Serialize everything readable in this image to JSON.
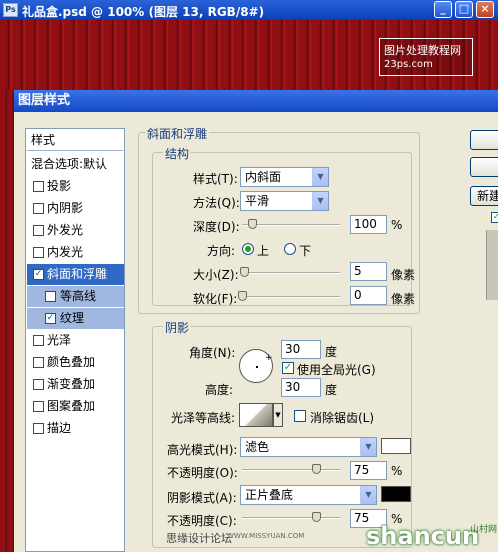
{
  "window": {
    "title": "礼品盒.psd @ 100% (图层 13, RGB/8#)",
    "buttons": {
      "minimize": "_",
      "maximize": "□",
      "close": "×"
    },
    "app_icon": "Ps"
  },
  "watermark": {
    "line1": "图片处理教程网",
    "line2": "23ps.com"
  },
  "dialog": {
    "title": "图层样式",
    "right_buttons": {
      "new_style": "新建"
    },
    "preview_check": "✓"
  },
  "style_list": {
    "header": "样式",
    "blend": "混合选项:默认",
    "items": [
      {
        "label": "投影",
        "checked": ""
      },
      {
        "label": "内阴影",
        "checked": ""
      },
      {
        "label": "外发光",
        "checked": ""
      },
      {
        "label": "内发光",
        "checked": ""
      },
      {
        "label": "斜面和浮雕",
        "checked": "✓"
      },
      {
        "label": "等高线",
        "checked": ""
      },
      {
        "label": "纹理",
        "checked": "✓"
      },
      {
        "label": "光泽",
        "checked": ""
      },
      {
        "label": "颜色叠加",
        "checked": ""
      },
      {
        "label": "渐变叠加",
        "checked": ""
      },
      {
        "label": "图案叠加",
        "checked": ""
      },
      {
        "label": "描边",
        "checked": ""
      }
    ]
  },
  "bevel": {
    "section_title": "斜面和浮雕",
    "structure_title": "结构",
    "style_label": "样式(T):",
    "style_value": "内斜面",
    "technique_label": "方法(Q):",
    "technique_value": "平滑",
    "depth_label": "深度(D):",
    "depth_value": "100",
    "depth_unit": "%",
    "depth_level": 0.1,
    "direction_label": "方向:",
    "direction_up": "上",
    "direction_down": "下",
    "size_label": "大小(Z):",
    "size_value": "5",
    "size_unit": "像素",
    "size_level": 0.02,
    "soften_label": "软化(F):",
    "soften_value": "0",
    "soften_unit": "像素",
    "soften_level": 0.0
  },
  "shading": {
    "title": "阴影",
    "angle_label": "角度(N):",
    "angle_value": "30",
    "angle_unit": "度",
    "global_light_label": "使用全局光(G)",
    "global_light_checked": "✓",
    "altitude_label": "高度:",
    "altitude_value": "30",
    "altitude_unit": "度",
    "gloss_label": "光泽等高线:",
    "anti_alias_label": "消除锯齿(L)",
    "highlight_mode_label": "高光模式(H):",
    "highlight_mode_value": "滤色",
    "highlight_color": "#ffffff",
    "highlight_opacity_label": "不透明度(O):",
    "highlight_opacity_value": "75",
    "highlight_opacity_unit": "%",
    "highlight_opacity_level": 0.75,
    "shadow_mode_label": "阴影模式(A):",
    "shadow_mode_value": "正片叠底",
    "shadow_color": "#000000",
    "shadow_opacity_label": "不透明度(C):",
    "shadow_opacity_value": "75",
    "shadow_opacity_unit": "%",
    "shadow_opacity_level": 0.75
  },
  "footer": {
    "forum": "思缘设计论坛",
    "url": "WWW.MISSYUAN.COM",
    "brand": "shancun",
    "brand_cn": "山村网"
  }
}
